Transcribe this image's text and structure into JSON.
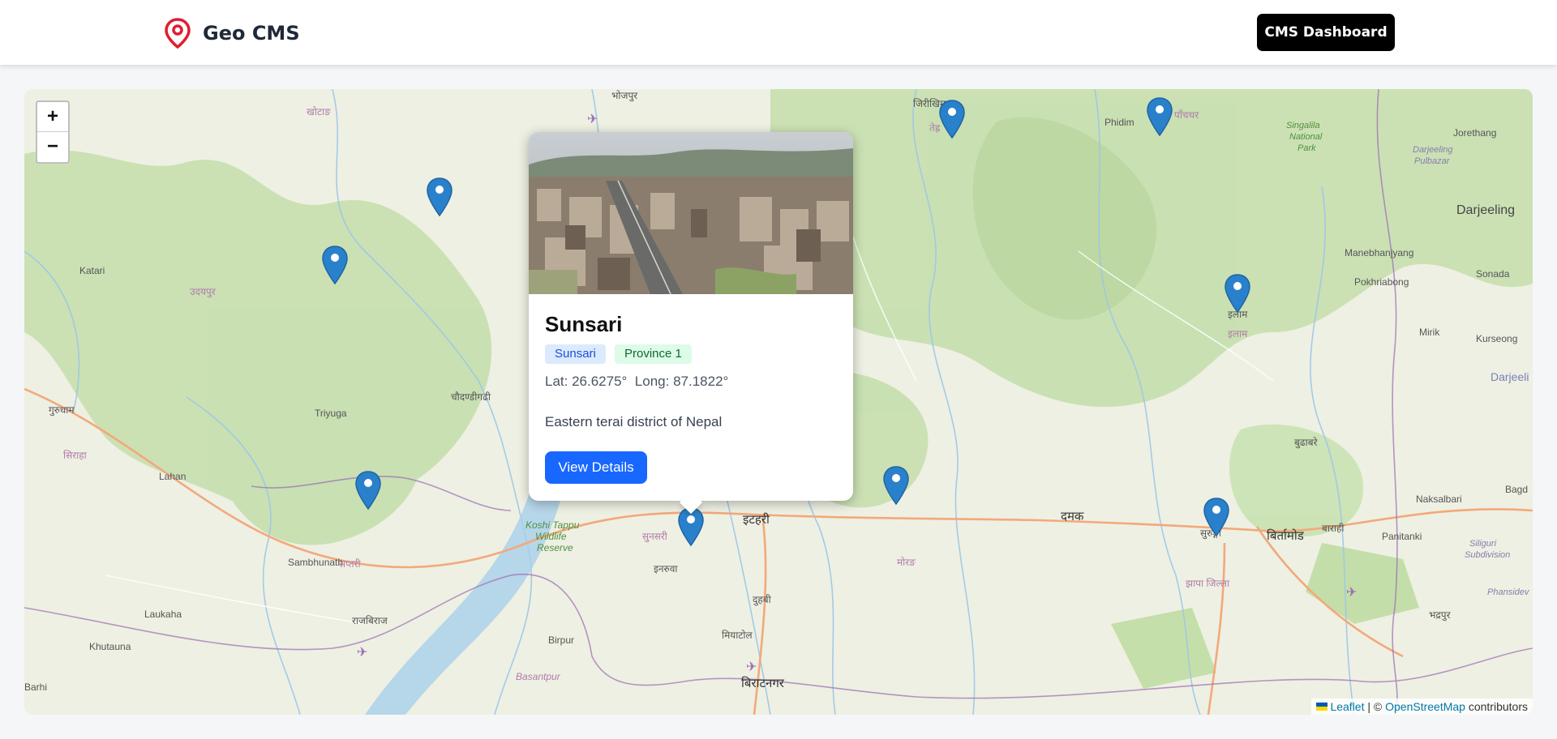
{
  "navbar": {
    "brand": "Geo CMS",
    "dashboard_button": "CMS Dashboard"
  },
  "map": {
    "zoom_in": "+",
    "zoom_out": "−",
    "labels": {
      "katari": "Katari",
      "triyuga": "Triyuga",
      "lahan": "Lahan",
      "sambhunath": "Sambhunath",
      "laukaha": "Laukaha",
      "khutauna": "Khutauna",
      "barhi": "Barhi",
      "birpur": "Birpur",
      "basantpur": "Basantpur",
      "koshi": "Koshi Tappu",
      "koshi2": "Wildlife",
      "koshi3": "Reserve",
      "phidim": "Phidim",
      "singalila": "Singalila",
      "singalila2": "National",
      "singalila3": "Park",
      "jorethang": "Jorethang",
      "darjeeling": "Darjeeling",
      "darj_pul": "Darjeeling",
      "darj_pul2": "Pulbazar",
      "manebhanjyang": "Manebhanjyang",
      "pokhriabong": "Pokhriabong",
      "sonada": "Sonada",
      "mirik": "Mirik",
      "kurseong": "Kurseong",
      "darjeel_cut": "Darjeeli",
      "naksalbari": "Naksalbari",
      "bagd": "Bagd",
      "panitanki": "Panitanki",
      "siliguri": "Siliguri",
      "siliguri2": "Subdivision",
      "phansidew": "Phansidev",
      "itahari": "इटहरी",
      "damak": "दमक",
      "birtamod": "बिर्तामोड",
      "biratnagar": "बिराटनगर",
      "inaruwa": "इनरुवा",
      "duhabi": "दुहबी",
      "miyatol": "मियाटोल",
      "sunsari_np": "सुनसरी",
      "morang_np": "मोरङ",
      "jhapa_np": "झापा जिल्ला",
      "ilam_np": "इलाम",
      "ilam_np2": "इलाम",
      "saptari_np": "सप्तरी",
      "siraha_np": "सिराहा",
      "rajbiraj_np": "राजबिराज",
      "udaypur_np": "उदयपुर",
      "chaudandi_np": "चौदण्डीगढी",
      "gaighat_np": "गुरुधाम",
      "khotang_np": "खोटाङ",
      "bhojpur_np": "भोजपुर",
      "jiri_np": "जिरीखिम",
      "tehr_np": "तेह्र",
      "pach_np": "पाँचथर",
      "budhabare_np": "बुढाबरे",
      "barahi_np": "बाराही",
      "surunga_np": "सुरुङ्गा",
      "bhadrapur_np": "भद्रपुर"
    },
    "attribution": {
      "leaflet": "Leaflet",
      "sep": " | © ",
      "osm": "OpenStreetMap",
      "contrib": " contributors"
    }
  },
  "popup": {
    "title": "Sunsari",
    "tag_district": "Sunsari",
    "tag_province": "Province 1",
    "lat": "26.6275°",
    "long": "87.1822°",
    "lat_label": "Lat:",
    "long_label": "Long:",
    "description": "Eastern terai district of Nepal",
    "button": "View Details"
  },
  "colors": {
    "marker": "#2a81cb",
    "accent_button": "#1867ff",
    "brand_icon": "#e11d2f"
  }
}
